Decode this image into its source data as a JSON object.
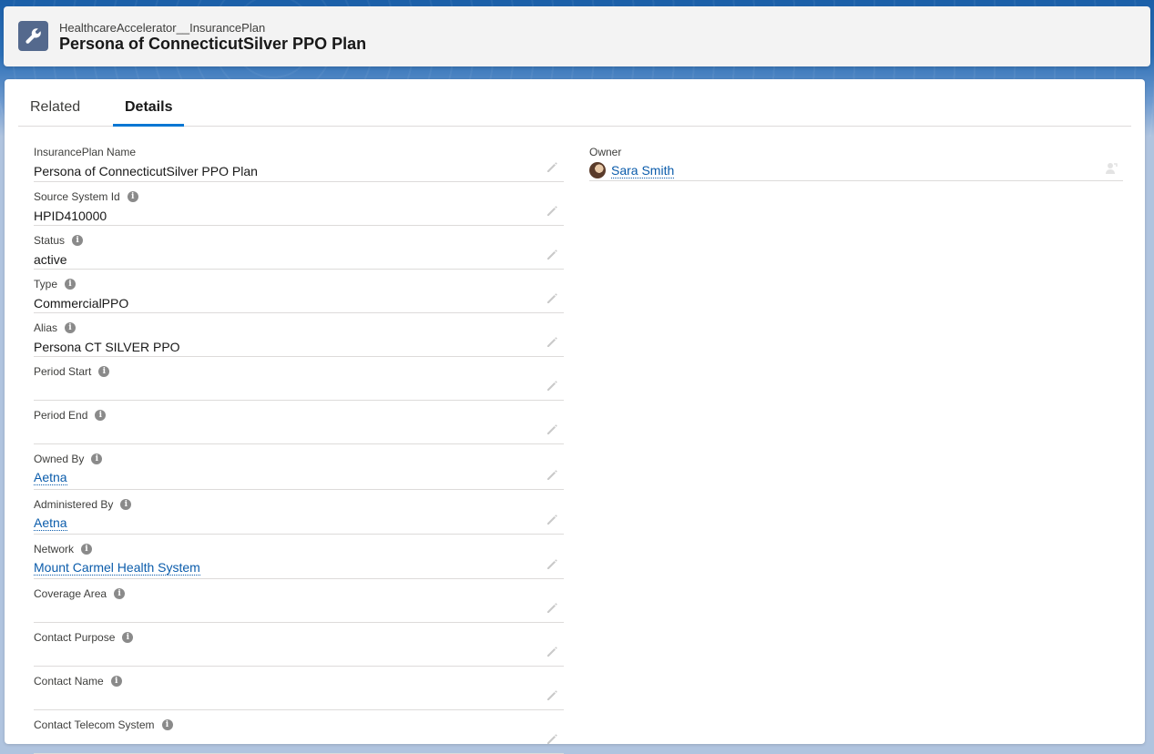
{
  "header": {
    "object_type": "HealthcareAccelerator__InsurancePlan",
    "title": "Persona of ConnecticutSilver PPO Plan",
    "icon": "wrench-icon"
  },
  "tabs": [
    {
      "label": "Related",
      "active": false
    },
    {
      "label": "Details",
      "active": true
    }
  ],
  "fields": [
    {
      "label": "InsurancePlan Name",
      "value": "Persona of ConnecticutSilver PPO Plan",
      "info": false,
      "link": false
    },
    {
      "label": "Source System Id",
      "value": "HPID410000",
      "info": true,
      "link": false
    },
    {
      "label": "Status",
      "value": "active",
      "info": true,
      "link": false
    },
    {
      "label": "Type",
      "value": "CommercialPPO",
      "info": true,
      "link": false
    },
    {
      "label": "Alias",
      "value": "Persona CT SILVER PPO",
      "info": true,
      "link": false
    },
    {
      "label": "Period Start",
      "value": "",
      "info": true,
      "link": false
    },
    {
      "label": "Period End",
      "value": "",
      "info": true,
      "link": false
    },
    {
      "label": "Owned By",
      "value": "Aetna",
      "info": true,
      "link": true
    },
    {
      "label": "Administered By",
      "value": "Aetna",
      "info": true,
      "link": true
    },
    {
      "label": "Network",
      "value": "Mount Carmel Health System",
      "info": true,
      "link": true
    },
    {
      "label": "Coverage Area",
      "value": "",
      "info": true,
      "link": false
    },
    {
      "label": "Contact Purpose",
      "value": "",
      "info": true,
      "link": false
    },
    {
      "label": "Contact Name",
      "value": "",
      "info": true,
      "link": false
    },
    {
      "label": "Contact Telecom System",
      "value": "",
      "info": true,
      "link": false
    }
  ],
  "owner": {
    "label": "Owner",
    "value": "Sara Smith"
  },
  "colors": {
    "brand_blue": "#0176d3",
    "link": "#0b5cab",
    "icon_bg": "#54698d"
  }
}
